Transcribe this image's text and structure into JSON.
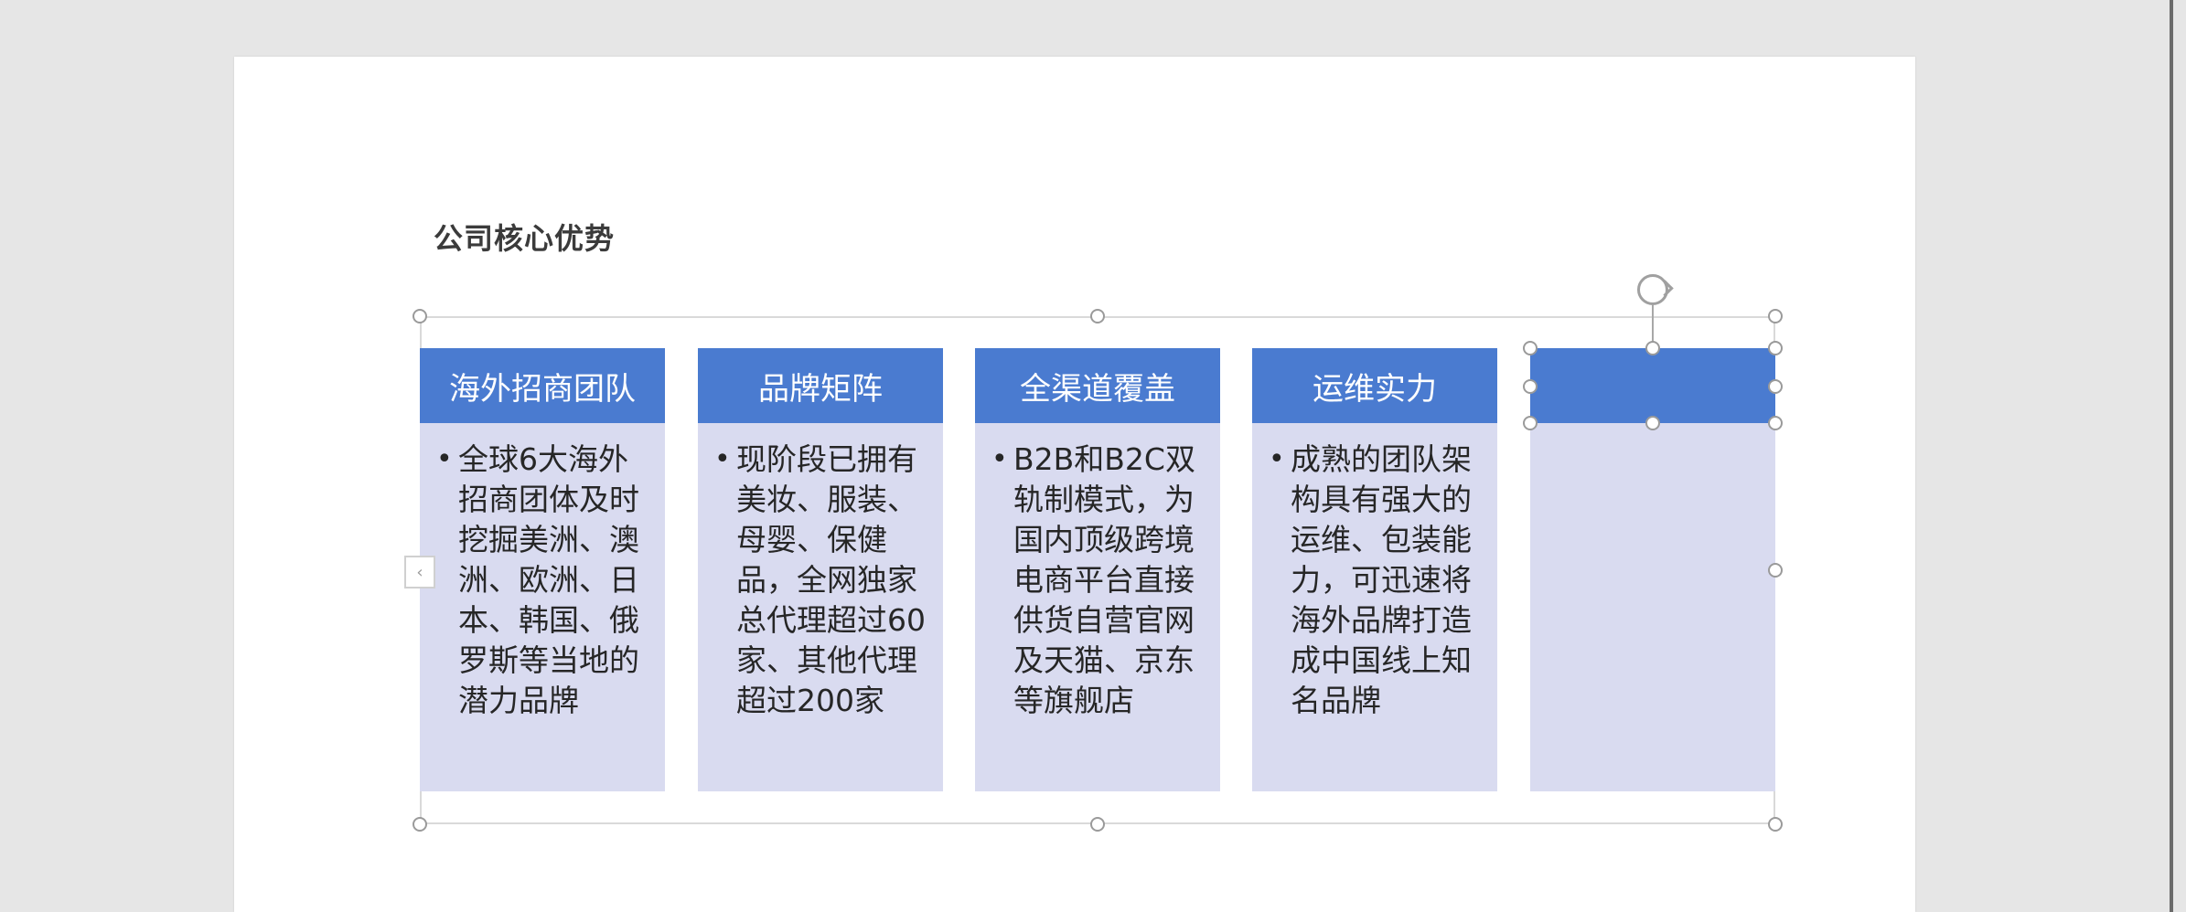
{
  "slide": {
    "title": "公司核心优势"
  },
  "smartart": {
    "columns": [
      {
        "header": "海外招商团队",
        "bullet": "•",
        "body": "全球6大海外招商团体及时挖掘美洲、澳洲、欧洲、日本、韩国、俄罗斯等当地的潜力品牌"
      },
      {
        "header": "品牌矩阵",
        "bullet": "•",
        "body": "现阶段已拥有美妆、服装、母婴、保健品，全网独家总代理超过60家、其他代理超过200家"
      },
      {
        "header": "全渠道覆盖",
        "bullet": "•",
        "body": "B2B和B2C双轨制模式，为国内顶级跨境电商平台直接供货自营官网及天猫、京东等旗舰店"
      },
      {
        "header": "运维实力",
        "bullet": "•",
        "body": "成熟的团队架构具有强大的运维、包装能力，可迅速将海外品牌打造成中国线上知名品牌"
      },
      {
        "header": "",
        "bullet": "",
        "body": ""
      }
    ]
  },
  "icons": {
    "rotate": "rotate-handle-icon",
    "expand": "chevron-left-icon"
  },
  "colors": {
    "header_fill": "#4a7bd0",
    "body_fill": "#d9dbf0",
    "canvas": "#e6e6e6",
    "slide": "#ffffff"
  }
}
